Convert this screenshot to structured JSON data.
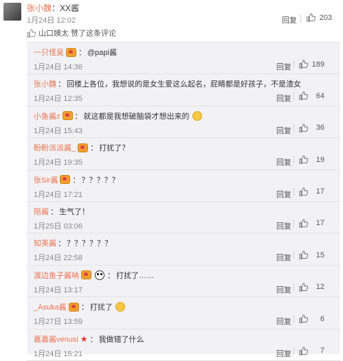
{
  "top_comment": {
    "user": "张小魏",
    "separator": "：",
    "text": "XX酱",
    "time": "1月24日 12:02",
    "reply_label": "回复",
    "likes": "203",
    "liked_by_text": "山口姨太 赞了这条评论"
  },
  "replies": [
    {
      "user": "一只怪吴",
      "badge": true,
      "separator": "：",
      "text": "@papi酱",
      "emoji_end": false,
      "time": "1月24日 14:36",
      "reply_label": "回复",
      "likes": "189"
    },
    {
      "user": "张小魏",
      "badge": false,
      "separator": "：",
      "text": "回楼上各位，我想说的是女生爱这么起名，屁睛都是好孩子，不是渣女",
      "emoji_end": false,
      "time": "1月24日 12:35",
      "reply_label": "回复",
      "likes": "64"
    },
    {
      "user": "小鱼酱z",
      "badge": true,
      "separator": "：",
      "text": "就这都是我想破脑袋才想出来的",
      "emoji_end": true,
      "time": "1月24日 15:43",
      "reply_label": "回复",
      "likes": "36"
    },
    {
      "user": "盼盼派派酱_",
      "badge": true,
      "separator": "：",
      "text": "打扰了？",
      "emoji_end": false,
      "time": "1月24日 19:35",
      "reply_label": "回复",
      "likes": "19"
    },
    {
      "user": "张Sir酱",
      "badge": true,
      "separator": "：",
      "text": "？？？？？",
      "emoji_end": false,
      "time": "1月24日 17:21",
      "reply_label": "回复",
      "likes": "17"
    },
    {
      "user": "陪酱",
      "badge": false,
      "separator": "：",
      "text": "生气了！",
      "emoji_end": false,
      "time": "1月25日 03:06",
      "reply_label": "回复",
      "likes": "17"
    },
    {
      "user": "知英酱",
      "badge": false,
      "separator": "：",
      "text": "？？？？？？",
      "emoji_end": false,
      "time": "1月24日 22:58",
      "reply_label": "回复",
      "likes": "15"
    },
    {
      "user": "渡边鱼子酱呐",
      "badge": true,
      "panda": true,
      "separator": "：",
      "text": "打扰了……",
      "emoji_end": false,
      "time": "1月24日 13:17",
      "reply_label": "回复",
      "likes": "12"
    },
    {
      "user": "_Asuka酱",
      "badge": true,
      "separator": "：",
      "text": "打扰了",
      "emoji_end": true,
      "time": "1月27日 13:59",
      "reply_label": "回复",
      "likes": "6"
    },
    {
      "user": "嘉嘉酱venusi",
      "badge": false,
      "star": true,
      "separator": "：",
      "text": "我做错了什么",
      "emoji_end": false,
      "time": "1月24日 15:21",
      "reply_label": "回复",
      "likes": "7"
    }
  ]
}
